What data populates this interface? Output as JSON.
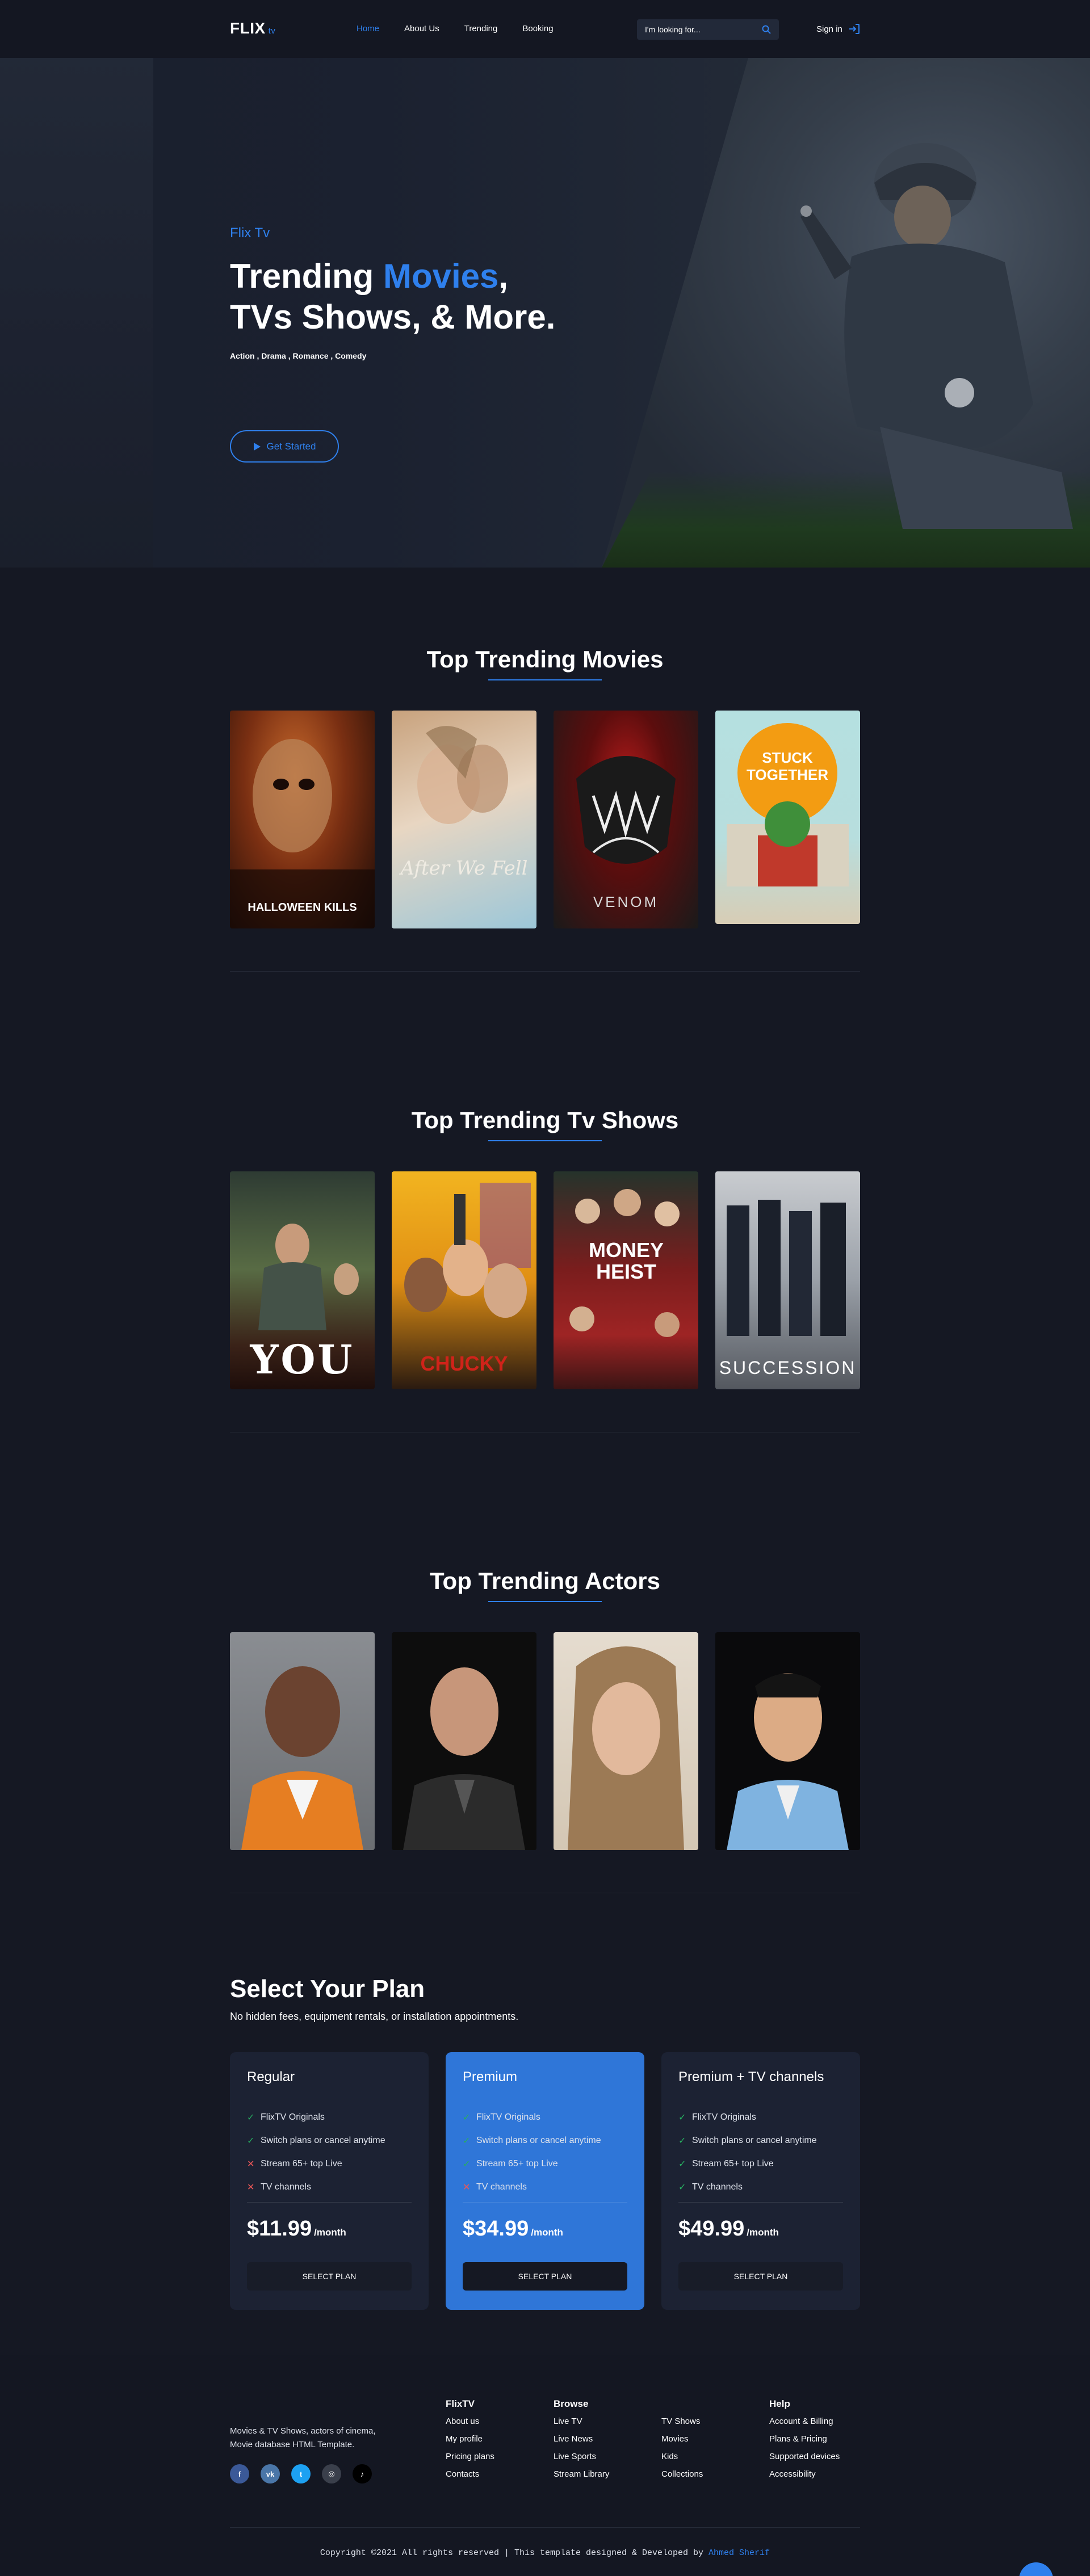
{
  "header": {
    "logo": "FLIX",
    "logo_suffix": "tv",
    "nav": [
      "Home",
      "About Us",
      "Trending",
      "Booking"
    ],
    "search_placeholder": "I'm looking for...",
    "signin_label": "Sign in"
  },
  "hero": {
    "kicker": "Flix Tv",
    "title_line1_a": "Trending ",
    "title_line1_b": "Movies",
    "title_line1_c": ",",
    "title_line2": "TVs Shows, & More.",
    "genres": "Action , Drama , Romance , Comedy",
    "cta_label": "Get Started"
  },
  "movies": {
    "title": "Top Trending Movies",
    "items": [
      "HALLOWEEN KILLS",
      "After We Fell",
      "VENOM",
      "STUCK TOGETHER"
    ]
  },
  "tvshows": {
    "title": "Top Trending Tv Shows",
    "items": [
      "YOU",
      "CHUCKY",
      "MONEY HEIST",
      "SUCCESSION"
    ]
  },
  "actors": {
    "title": "Top Trending Actors"
  },
  "plans": {
    "title": "Select Your Plan",
    "subtitle": "No hidden fees, equipment rentals, or installation appointments.",
    "items": [
      {
        "name": "Regular",
        "features": [
          "FlixTV Originals",
          "Switch plans or cancel anytime",
          "Stream 65+ top Live",
          "TV channels"
        ],
        "included": [
          true,
          true,
          false,
          false
        ],
        "price": "$11.99",
        "period": "/month",
        "button": "SELECT PLAN"
      },
      {
        "name": "Premium",
        "features": [
          "FlixTV Originals",
          "Switch plans or cancel anytime",
          "Stream 65+ top Live",
          "TV channels"
        ],
        "included": [
          true,
          true,
          true,
          false
        ],
        "price": "$34.99",
        "period": "/month",
        "button": "SELECT PLAN"
      },
      {
        "name": "Premium + TV channels",
        "features": [
          "FlixTV Originals",
          "Switch plans or cancel anytime",
          "Stream 65+ top Live",
          "TV channels"
        ],
        "included": [
          true,
          true,
          true,
          true
        ],
        "price": "$49.99",
        "period": "/month",
        "button": "SELECT PLAN"
      }
    ]
  },
  "footer": {
    "description": "Movies & TV Shows, actors of cinema, Movie database HTML Template.",
    "social": [
      {
        "icon": "facebook-icon",
        "glyph": "f",
        "color": "#3b5998"
      },
      {
        "icon": "vk-icon",
        "glyph": "vk",
        "color": "#4a76a8"
      },
      {
        "icon": "twitter-icon",
        "glyph": "t",
        "color": "#1da1f2"
      },
      {
        "icon": "instagram-icon",
        "glyph": "◎",
        "color": "#3a3f4b"
      },
      {
        "icon": "tiktok-icon",
        "glyph": "♪",
        "color": "#000000"
      }
    ],
    "columns": [
      {
        "title": "FlixTV",
        "links": [
          "About us",
          "My profile",
          "Pricing plans",
          "Contacts"
        ]
      },
      {
        "title": "Browse",
        "links": [
          "Live TV",
          "Live News",
          "Live Sports",
          "Stream Library"
        ]
      },
      {
        "title": "",
        "links": [
          "TV Shows",
          "Movies",
          "Kids",
          "Collections"
        ]
      },
      {
        "title": "Help",
        "links": [
          "Account & Billing",
          "Plans & Pricing",
          "Supported devices",
          "Accessibility"
        ]
      }
    ],
    "copyright_text": "Copyright ©2021 All rights reserved | This template designed & Developed by ",
    "copyright_author": "Ahmed Sherif"
  },
  "colors": {
    "accent": "#2f80ed",
    "background": "#151823",
    "success": "#27ae60",
    "danger": "#eb5757"
  }
}
